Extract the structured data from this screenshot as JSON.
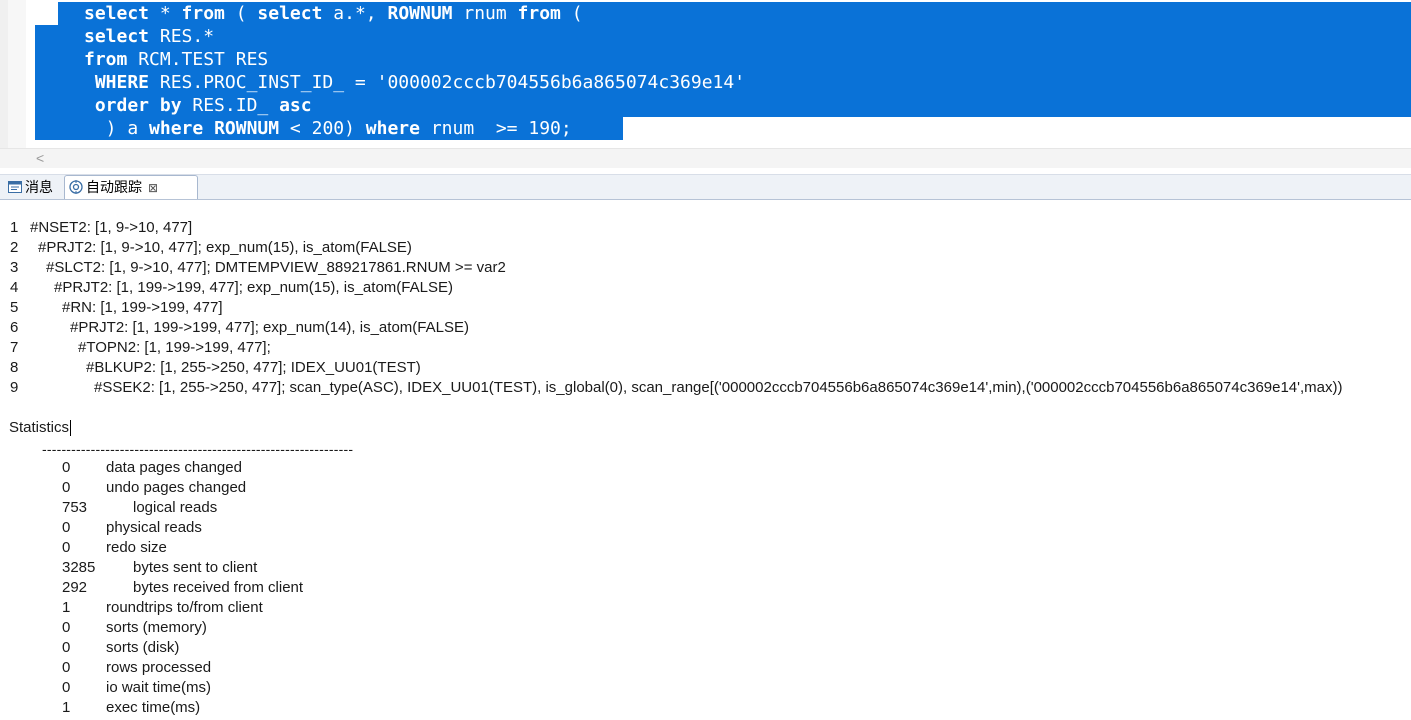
{
  "editor": {
    "lines": [
      [
        {
          "t": "select",
          "k": true
        },
        {
          "t": " * ",
          "k": false
        },
        {
          "t": "from",
          "k": true
        },
        {
          "t": " ( ",
          "k": false
        },
        {
          "t": "select",
          "k": true
        },
        {
          "t": " a.*, ",
          "k": false
        },
        {
          "t": "ROWNUM",
          "k": true
        },
        {
          "t": " rnum ",
          "k": false
        },
        {
          "t": "from",
          "k": true
        },
        {
          "t": " (",
          "k": false
        }
      ],
      [
        {
          "t": "select",
          "k": true
        },
        {
          "t": " RES.*",
          "k": false
        }
      ],
      [
        {
          "t": "from",
          "k": true
        },
        {
          "t": " RCM.TEST RES",
          "k": false
        }
      ],
      [
        {
          "t": " WHERE",
          "k": true
        },
        {
          "t": " RES.PROC_INST_ID_ = '000002cccb704556b6a865074c369e14'",
          "k": false
        }
      ],
      [
        {
          "t": " order by",
          "k": true
        },
        {
          "t": " RES.ID_ ",
          "k": false
        },
        {
          "t": "asc",
          "k": true
        }
      ],
      [
        {
          "t": "  ) a ",
          "k": false
        },
        {
          "t": "where",
          "k": true
        },
        {
          "t": " ",
          "k": false
        },
        {
          "t": "ROWNUM",
          "k": true
        },
        {
          "t": " < 200) ",
          "k": false
        },
        {
          "t": "where",
          "k": true
        },
        {
          "t": " rnum  >= 190;",
          "k": false
        }
      ]
    ],
    "scroll_left": "<"
  },
  "tabs": {
    "messages": "消息",
    "autotrace": "自动跟踪",
    "close": "⊠"
  },
  "plan": [
    {
      "n": "1",
      "text": "#NSET2: [1, 9->10, 477]"
    },
    {
      "n": "2",
      "text": "#PRJT2: [1, 9->10, 477]; exp_num(15), is_atom(FALSE)"
    },
    {
      "n": "3",
      "text": "#SLCT2: [1, 9->10, 477]; DMTEMPVIEW_889217861.RNUM >= var2"
    },
    {
      "n": "4",
      "text": "#PRJT2: [1, 199->199, 477]; exp_num(15), is_atom(FALSE)"
    },
    {
      "n": "5",
      "text": "#RN: [1, 199->199, 477]"
    },
    {
      "n": "6",
      "text": "#PRJT2: [1, 199->199, 477]; exp_num(14), is_atom(FALSE)"
    },
    {
      "n": "7",
      "text": "#TOPN2: [1, 199->199, 477];"
    },
    {
      "n": "8",
      "text": "#BLKUP2: [1, 255->250, 477]; IDEX_UU01(TEST)"
    },
    {
      "n": "9",
      "text": "#SSEK2: [1, 255->250, 477]; scan_type(ASC), IDEX_UU01(TEST), is_global(0), scan_range[('000002cccb704556b6a865074c369e14',min),('000002cccb704556b6a865074c369e14',max))"
    }
  ],
  "statistics": {
    "title": "Statistics",
    "separator": "----------------------------------------------------------------",
    "rows": [
      {
        "value": "0",
        "label": "data pages changed"
      },
      {
        "value": "0",
        "label": "undo pages changed"
      },
      {
        "value": "753",
        "label": "logical reads"
      },
      {
        "value": "0",
        "label": "physical reads"
      },
      {
        "value": "0",
        "label": "redo size"
      },
      {
        "value": "3285",
        "label": "bytes sent to client"
      },
      {
        "value": "292",
        "label": "bytes received from client"
      },
      {
        "value": "1",
        "label": "roundtrips to/from client"
      },
      {
        "value": "0",
        "label": "sorts (memory)"
      },
      {
        "value": "0",
        "label": "sorts (disk)"
      },
      {
        "value": "0",
        "label": "rows processed"
      },
      {
        "value": "0",
        "label": "io wait time(ms)"
      },
      {
        "value": "1",
        "label": "exec time(ms)"
      }
    ]
  }
}
